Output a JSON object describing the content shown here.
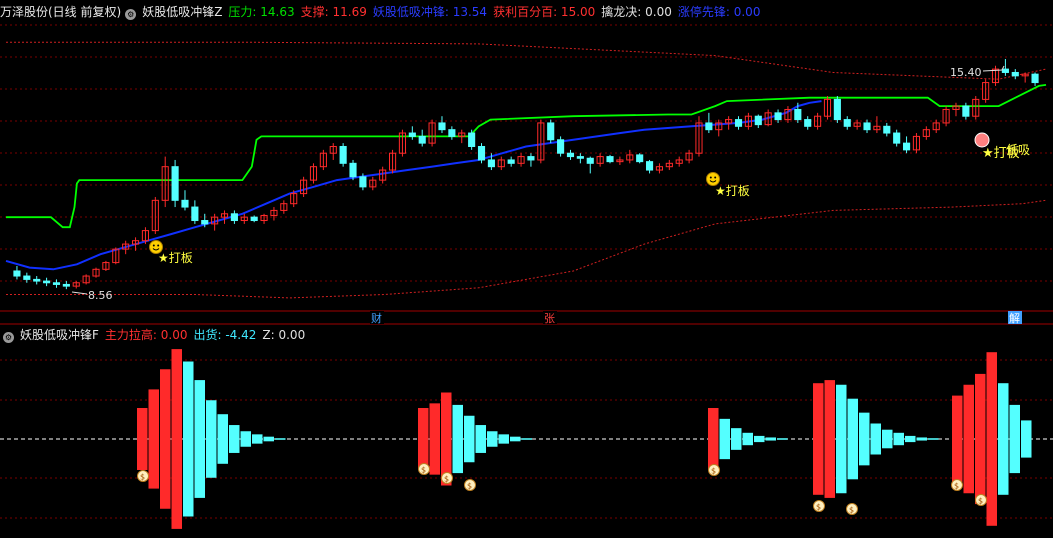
{
  "header_top": {
    "stock": "万泽股份(日线 前复权)",
    "indicator": "妖股低吸冲锋Z",
    "items": [
      {
        "label": "压力:",
        "value": "14.63",
        "color": "#00e000"
      },
      {
        "label": "支撑:",
        "value": "11.69",
        "color": "#ff3030"
      },
      {
        "label": "妖股低吸冲锋:",
        "value": "13.54",
        "color": "#2a3cff"
      },
      {
        "label": "获利百分百:",
        "value": "15.00",
        "color": "#ff3030"
      },
      {
        "label": "擒龙决:",
        "value": "0.00",
        "color": "#e0e0e0"
      },
      {
        "label": "涨停先锋:",
        "value": "0.00",
        "color": "#2a3cff"
      }
    ]
  },
  "header_bottom": {
    "indicator": "妖股低吸冲锋F",
    "items": [
      {
        "label": "主力拉高:",
        "value": "0.00",
        "color": "#ff3030"
      },
      {
        "label": "出货:",
        "value": "-4.42",
        "color": "#40e8ff"
      },
      {
        "label": "Z:",
        "value": "0.00",
        "color": "#e0e0e0"
      }
    ]
  },
  "markers": {
    "hi_label": "15.40",
    "lo_label": "8.56",
    "signal": "打板",
    "signal2": "低吸",
    "cai": "财",
    "zhang": "张",
    "jie": "解"
  },
  "colors": {
    "up": "#ff2a2a",
    "down": "#54ffff",
    "resist": "#00ff00",
    "support": "#1030ff",
    "band": "#d02020",
    "grid": "#7a0000"
  },
  "chart_data": [
    {
      "type": "candlestick",
      "title": "万泽股份(日线 前复权)",
      "ylim": [
        8.0,
        16.5
      ],
      "candles": [
        [
          9.1,
          9.25,
          8.85,
          8.95
        ],
        [
          8.95,
          9.05,
          8.75,
          8.85
        ],
        [
          8.85,
          8.95,
          8.7,
          8.8
        ],
        [
          8.8,
          8.9,
          8.65,
          8.75
        ],
        [
          8.75,
          8.85,
          8.6,
          8.7
        ],
        [
          8.7,
          8.8,
          8.56,
          8.65
        ],
        [
          8.65,
          8.8,
          8.58,
          8.75
        ],
        [
          8.75,
          9.0,
          8.7,
          8.95
        ],
        [
          8.95,
          9.2,
          8.9,
          9.15
        ],
        [
          9.15,
          9.4,
          9.1,
          9.35
        ],
        [
          9.35,
          9.8,
          9.3,
          9.75
        ],
        [
          9.75,
          10.0,
          9.6,
          9.9
        ],
        [
          9.9,
          10.1,
          9.7,
          10.0
        ],
        [
          10.0,
          10.4,
          9.9,
          10.3
        ],
        [
          10.3,
          11.3,
          10.2,
          11.2
        ],
        [
          11.2,
          12.5,
          11.0,
          12.2
        ],
        [
          12.2,
          12.4,
          11.0,
          11.2
        ],
        [
          11.2,
          11.5,
          10.9,
          11.0
        ],
        [
          11.0,
          11.2,
          10.5,
          10.6
        ],
        [
          10.6,
          10.8,
          10.4,
          10.5
        ],
        [
          10.5,
          10.8,
          10.3,
          10.7
        ],
        [
          10.7,
          10.9,
          10.5,
          10.8
        ],
        [
          10.8,
          10.9,
          10.5,
          10.6
        ],
        [
          10.6,
          10.8,
          10.5,
          10.7
        ],
        [
          10.7,
          10.75,
          10.55,
          10.6
        ],
        [
          10.6,
          10.8,
          10.5,
          10.75
        ],
        [
          10.75,
          11.0,
          10.6,
          10.9
        ],
        [
          10.9,
          11.2,
          10.8,
          11.1
        ],
        [
          11.1,
          11.5,
          11.0,
          11.4
        ],
        [
          11.4,
          11.9,
          11.3,
          11.8
        ],
        [
          11.8,
          12.3,
          11.7,
          12.2
        ],
        [
          12.2,
          12.7,
          12.1,
          12.6
        ],
        [
          12.6,
          12.9,
          12.4,
          12.8
        ],
        [
          12.8,
          12.9,
          12.2,
          12.3
        ],
        [
          12.3,
          12.4,
          11.8,
          11.9
        ],
        [
          11.9,
          12.0,
          11.5,
          11.6
        ],
        [
          11.6,
          11.9,
          11.5,
          11.8
        ],
        [
          11.8,
          12.2,
          11.7,
          12.1
        ],
        [
          12.1,
          12.7,
          12.0,
          12.6
        ],
        [
          12.6,
          13.3,
          12.5,
          13.2
        ],
        [
          13.2,
          13.4,
          13.0,
          13.1
        ],
        [
          13.1,
          13.3,
          12.8,
          12.9
        ],
        [
          12.9,
          13.6,
          12.8,
          13.5
        ],
        [
          13.5,
          13.7,
          13.2,
          13.3
        ],
        [
          13.3,
          13.4,
          13.0,
          13.1
        ],
        [
          13.1,
          13.3,
          12.9,
          13.2
        ],
        [
          13.2,
          13.3,
          12.7,
          12.8
        ],
        [
          12.8,
          12.9,
          12.3,
          12.4
        ],
        [
          12.4,
          12.6,
          12.1,
          12.2
        ],
        [
          12.2,
          12.5,
          12.1,
          12.4
        ],
        [
          12.4,
          12.5,
          12.2,
          12.3
        ],
        [
          12.3,
          12.6,
          12.2,
          12.5
        ],
        [
          12.5,
          12.6,
          12.2,
          12.4
        ],
        [
          12.4,
          13.6,
          12.3,
          13.5
        ],
        [
          13.5,
          13.6,
          12.9,
          13.0
        ],
        [
          13.0,
          13.1,
          12.5,
          12.6
        ],
        [
          12.6,
          12.7,
          12.4,
          12.5
        ],
        [
          12.5,
          12.6,
          12.3,
          12.45
        ],
        [
          12.45,
          12.5,
          12.0,
          12.3
        ],
        [
          12.3,
          12.6,
          12.2,
          12.5
        ],
        [
          12.5,
          12.55,
          12.3,
          12.35
        ],
        [
          12.35,
          12.5,
          12.25,
          12.4
        ],
        [
          12.4,
          12.7,
          12.3,
          12.55
        ],
        [
          12.55,
          12.6,
          12.3,
          12.35
        ],
        [
          12.35,
          12.4,
          12.0,
          12.1
        ],
        [
          12.1,
          12.3,
          12.0,
          12.2
        ],
        [
          12.2,
          12.4,
          12.1,
          12.3
        ],
        [
          12.3,
          12.5,
          12.2,
          12.4
        ],
        [
          12.4,
          12.7,
          12.3,
          12.6
        ],
        [
          12.6,
          13.7,
          12.5,
          13.5
        ],
        [
          13.5,
          13.8,
          13.2,
          13.3
        ],
        [
          13.3,
          13.6,
          13.1,
          13.5
        ],
        [
          13.5,
          13.7,
          13.3,
          13.6
        ],
        [
          13.6,
          13.7,
          13.3,
          13.4
        ],
        [
          13.4,
          13.8,
          13.3,
          13.7
        ],
        [
          13.7,
          13.75,
          13.35,
          13.45
        ],
        [
          13.45,
          13.9,
          13.4,
          13.8
        ],
        [
          13.8,
          13.9,
          13.5,
          13.6
        ],
        [
          13.6,
          14.0,
          13.5,
          13.9
        ],
        [
          13.9,
          14.1,
          13.5,
          13.6
        ],
        [
          13.6,
          13.7,
          13.3,
          13.4
        ],
        [
          13.4,
          13.8,
          13.3,
          13.7
        ],
        [
          13.7,
          14.3,
          13.6,
          14.2
        ],
        [
          14.2,
          14.3,
          13.5,
          13.6
        ],
        [
          13.6,
          13.7,
          13.3,
          13.4
        ],
        [
          13.4,
          13.6,
          13.3,
          13.5
        ],
        [
          13.5,
          13.6,
          13.2,
          13.3
        ],
        [
          13.3,
          13.7,
          13.2,
          13.4
        ],
        [
          13.4,
          13.5,
          13.1,
          13.2
        ],
        [
          13.2,
          13.3,
          12.8,
          12.9
        ],
        [
          12.9,
          13.1,
          12.6,
          12.7
        ],
        [
          12.7,
          13.2,
          12.6,
          13.1
        ],
        [
          13.1,
          13.4,
          13.0,
          13.3
        ],
        [
          13.3,
          13.6,
          13.2,
          13.5
        ],
        [
          13.5,
          14.0,
          13.4,
          13.9
        ],
        [
          13.9,
          14.1,
          13.7,
          14.0
        ],
        [
          14.0,
          14.1,
          13.6,
          13.7
        ],
        [
          13.7,
          14.3,
          13.6,
          14.2
        ],
        [
          14.2,
          14.8,
          14.1,
          14.7
        ],
        [
          14.7,
          15.2,
          14.6,
          15.1
        ],
        [
          15.1,
          15.4,
          14.9,
          15.0
        ],
        [
          15.0,
          15.1,
          14.8,
          14.9
        ],
        [
          14.9,
          15.0,
          14.7,
          14.95
        ],
        [
          14.95,
          15.0,
          14.6,
          14.7
        ]
      ],
      "resistance": [
        [
          0,
          10.7
        ],
        [
          19,
          10.7
        ],
        [
          24,
          10.4
        ],
        [
          27,
          10.4
        ],
        [
          29,
          11.0
        ],
        [
          30,
          11.7
        ],
        [
          31,
          11.8
        ],
        [
          100,
          11.8
        ],
        [
          102,
          12.0
        ],
        [
          104,
          12.2
        ],
        [
          106,
          13.0
        ],
        [
          108,
          13.1
        ],
        [
          196,
          13.1
        ],
        [
          200,
          13.4
        ],
        [
          205,
          13.6
        ],
        [
          240,
          13.7
        ],
        [
          280,
          13.75
        ],
        [
          290,
          13.75
        ],
        [
          300,
          14.0
        ],
        [
          305,
          14.15
        ],
        [
          340,
          14.25
        ],
        [
          390,
          14.25
        ],
        [
          395,
          14.0
        ],
        [
          420,
          14.0
        ],
        [
          437,
          14.6
        ],
        [
          440,
          14.63
        ]
      ],
      "support_line": [
        [
          0,
          9.4
        ],
        [
          10,
          9.2
        ],
        [
          20,
          9.15
        ],
        [
          30,
          9.3
        ],
        [
          40,
          9.6
        ],
        [
          50,
          9.8
        ],
        [
          60,
          10.0
        ],
        [
          70,
          10.2
        ],
        [
          80,
          10.4
        ],
        [
          90,
          10.6
        ],
        [
          100,
          10.8
        ],
        [
          110,
          11.1
        ],
        [
          120,
          11.4
        ],
        [
          130,
          11.6
        ],
        [
          140,
          11.8
        ],
        [
          150,
          11.9
        ],
        [
          160,
          12.0
        ],
        [
          170,
          12.1
        ],
        [
          180,
          12.2
        ],
        [
          190,
          12.3
        ],
        [
          200,
          12.4
        ],
        [
          210,
          12.6
        ],
        [
          220,
          12.8
        ],
        [
          230,
          12.9
        ],
        [
          240,
          13.0
        ],
        [
          250,
          13.1
        ],
        [
          260,
          13.2
        ],
        [
          270,
          13.3
        ],
        [
          280,
          13.35
        ],
        [
          290,
          13.4
        ],
        [
          300,
          13.45
        ],
        [
          310,
          13.5
        ],
        [
          320,
          13.6
        ],
        [
          330,
          13.8
        ],
        [
          335,
          14.0
        ],
        [
          340,
          14.1
        ],
        [
          345,
          14.15
        ]
      ],
      "band_upper": [
        [
          0,
          15.9
        ],
        [
          100,
          15.9
        ],
        [
          200,
          15.85
        ],
        [
          300,
          15.5
        ],
        [
          350,
          15.0
        ],
        [
          420,
          14.8
        ],
        [
          440,
          15.1
        ]
      ],
      "band_lower": [
        [
          0,
          8.4
        ],
        [
          80,
          8.4
        ],
        [
          120,
          8.3
        ],
        [
          160,
          8.4
        ],
        [
          200,
          8.6
        ],
        [
          240,
          9.1
        ],
        [
          270,
          9.9
        ],
        [
          300,
          10.5
        ],
        [
          350,
          10.9
        ],
        [
          400,
          11.0
        ],
        [
          430,
          11.1
        ],
        [
          440,
          11.2
        ]
      ]
    },
    {
      "type": "bar",
      "title": "妖股低吸冲锋F",
      "ylim": [
        -6,
        6
      ],
      "groups": [
        {
          "start": 137,
          "red": [
            2.0,
            3.2,
            4.5,
            5.8
          ],
          "cyan": [
            5.0,
            3.8,
            2.5,
            1.6,
            0.9,
            0.5,
            0.3,
            0.15,
            0.05
          ]
        },
        {
          "start": 418,
          "red": [
            2.0,
            2.3,
            3.0
          ],
          "cyan": [
            2.2,
            1.5,
            0.9,
            0.5,
            0.3,
            0.15,
            0.05
          ]
        },
        {
          "start": 708,
          "red": [
            2.0
          ],
          "cyan": [
            1.3,
            0.7,
            0.4,
            0.2,
            0.1,
            0.05
          ]
        },
        {
          "start": 813,
          "red": [
            3.6,
            3.8
          ],
          "cyan": [
            3.5,
            2.6,
            1.7,
            1.0,
            0.6,
            0.4,
            0.2,
            0.1,
            0.05
          ]
        },
        {
          "start": 952,
          "red": [
            2.8,
            3.5,
            4.2,
            5.6
          ],
          "cyan": [
            3.6,
            2.2,
            1.2
          ]
        }
      ]
    }
  ]
}
